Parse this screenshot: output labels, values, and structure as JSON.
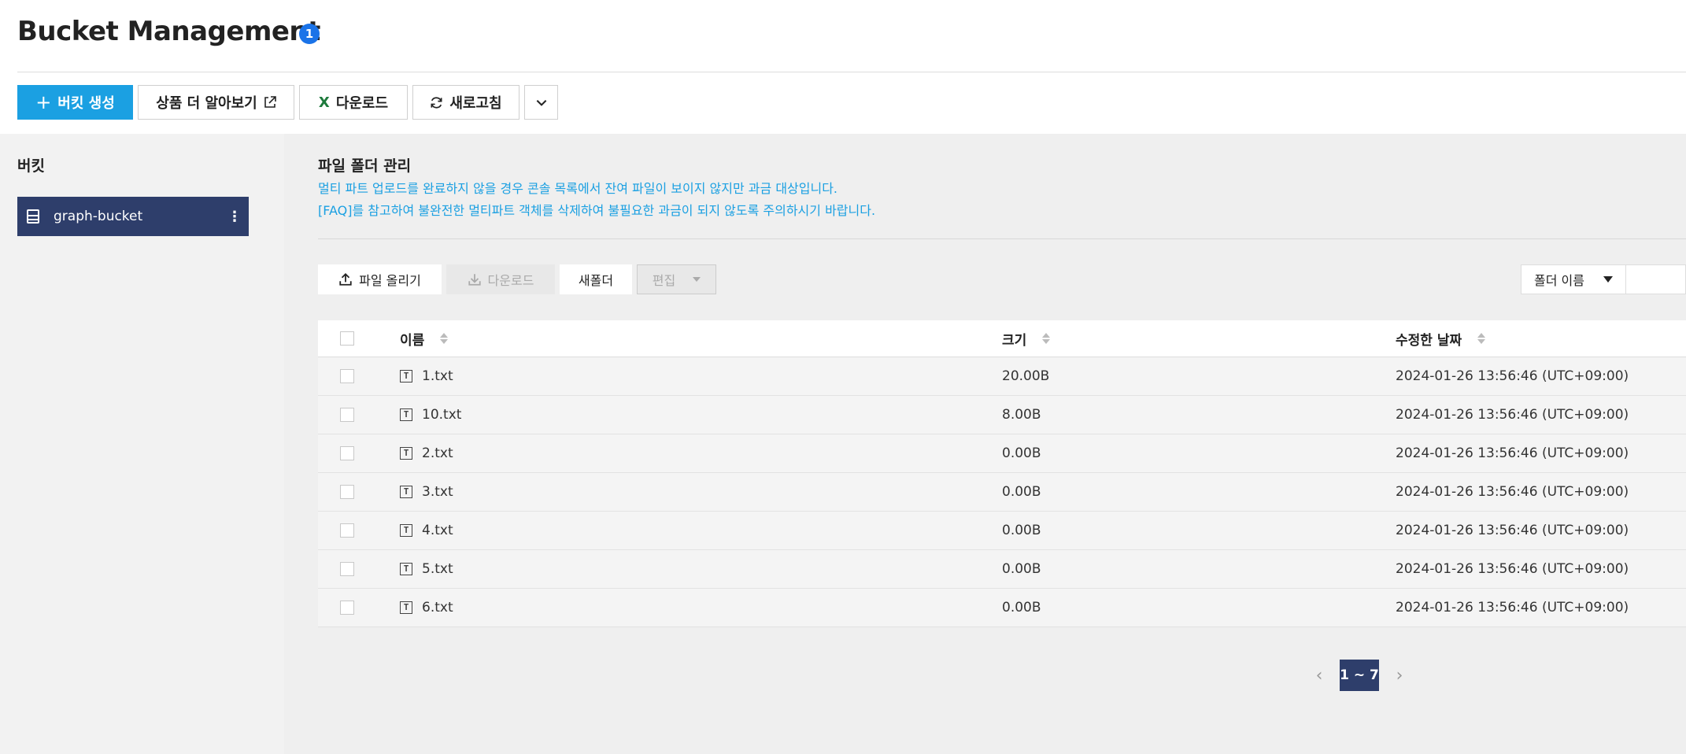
{
  "header": {
    "title": "Bucket Management",
    "badge": "1"
  },
  "toolbar": {
    "create_bucket": "버킷 생성",
    "learn_more": "상품 더 알아보기",
    "download": "다운로드",
    "refresh": "새로고침"
  },
  "sidebar": {
    "title": "버킷",
    "items": [
      {
        "label": "graph-bucket"
      }
    ]
  },
  "main": {
    "section_title": "파일 폴더 관리",
    "notice_line1": "멀티 파트 업로드를 완료하지 않을 경우 콘솔 목록에서 잔여 파일이 보이지 않지만 과금 대상입니다.",
    "notice_line2": "[FAQ]를 참고하여 불완전한 멀티파트 객체를 삭제하여 불필요한 과금이 되지 않도록 주의하시기 바랍니다.",
    "actions": {
      "upload": "파일 올리기",
      "download": "다운로드",
      "new_folder": "새폴더",
      "edit": "편집"
    },
    "folder_select": "폴더 이름",
    "table": {
      "headers": {
        "name": "이름",
        "size": "크기",
        "modified": "수정한 날짜"
      },
      "rows": [
        {
          "name": "1.txt",
          "size": "20.00B",
          "modified": "2024-01-26 13:56:46 (UTC+09:00)"
        },
        {
          "name": "10.txt",
          "size": "8.00B",
          "modified": "2024-01-26 13:56:46 (UTC+09:00)"
        },
        {
          "name": "2.txt",
          "size": "0.00B",
          "modified": "2024-01-26 13:56:46 (UTC+09:00)"
        },
        {
          "name": "3.txt",
          "size": "0.00B",
          "modified": "2024-01-26 13:56:46 (UTC+09:00)"
        },
        {
          "name": "4.txt",
          "size": "0.00B",
          "modified": "2024-01-26 13:56:46 (UTC+09:00)"
        },
        {
          "name": "5.txt",
          "size": "0.00B",
          "modified": "2024-01-26 13:56:46 (UTC+09:00)"
        },
        {
          "name": "6.txt",
          "size": "0.00B",
          "modified": "2024-01-26 13:56:46 (UTC+09:00)"
        }
      ]
    },
    "pagination": {
      "current": "1 ~ 7"
    }
  },
  "colors": {
    "primary": "#1ba0e2",
    "sidebar_selected": "#2e3e6b",
    "notice_text": "#1ba0e2"
  },
  "icons": {
    "create": "plus-icon",
    "external": "external-link-icon",
    "excel": "excel-icon",
    "refresh": "refresh-icon",
    "more": "chevron-down-icon",
    "bucket": "storage-icon",
    "file": "text-file-icon"
  }
}
